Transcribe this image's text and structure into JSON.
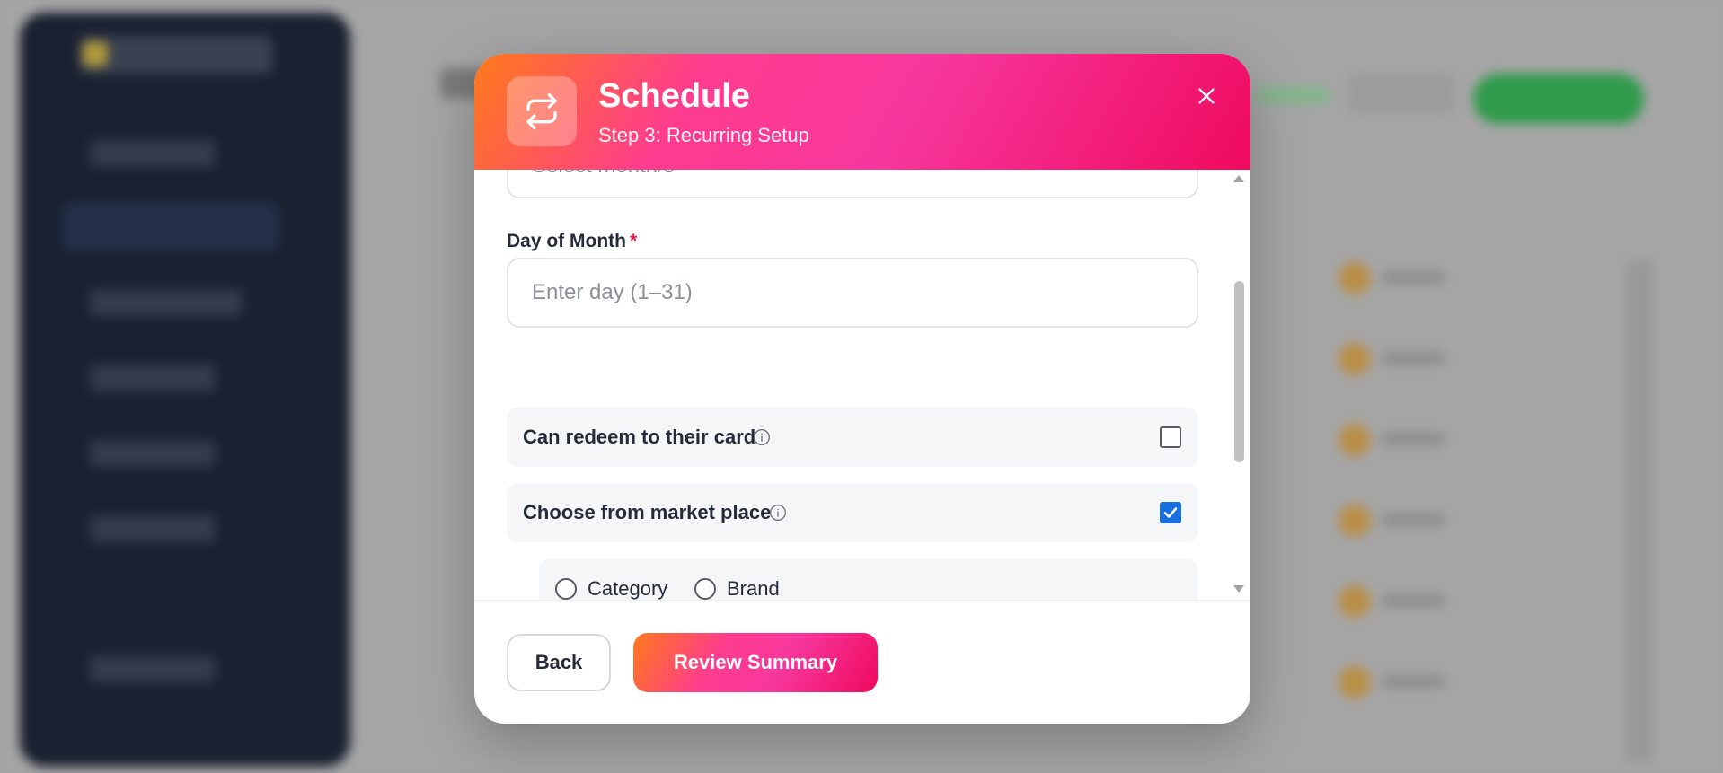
{
  "modal": {
    "title": "Schedule",
    "subtitle": "Step 3: Recurring Setup",
    "header_icon": "repeat-icon",
    "close_icon": "close-icon"
  },
  "form": {
    "previous_select_text": "Select month/s",
    "day_of_month": {
      "label": "Day of Month",
      "required_mark": "*",
      "placeholder": "Enter day (1–31)",
      "value": ""
    },
    "options": [
      {
        "label": "Can redeem to their card",
        "checked": false,
        "info_icon": "info-icon"
      },
      {
        "label": "Choose from market place",
        "checked": true,
        "info_icon": "info-icon"
      }
    ],
    "marketplace_choice": {
      "options": [
        "Category",
        "Brand"
      ],
      "selected": null
    }
  },
  "footer": {
    "back_label": "Back",
    "review_label": "Review Summary"
  },
  "colors": {
    "accent_start": "#ff7a1a",
    "accent_mid": "#ff3c8e",
    "accent_end": "#ef0a5e",
    "checkbox_checked": "#1a6fe0",
    "required": "#e11d48"
  }
}
